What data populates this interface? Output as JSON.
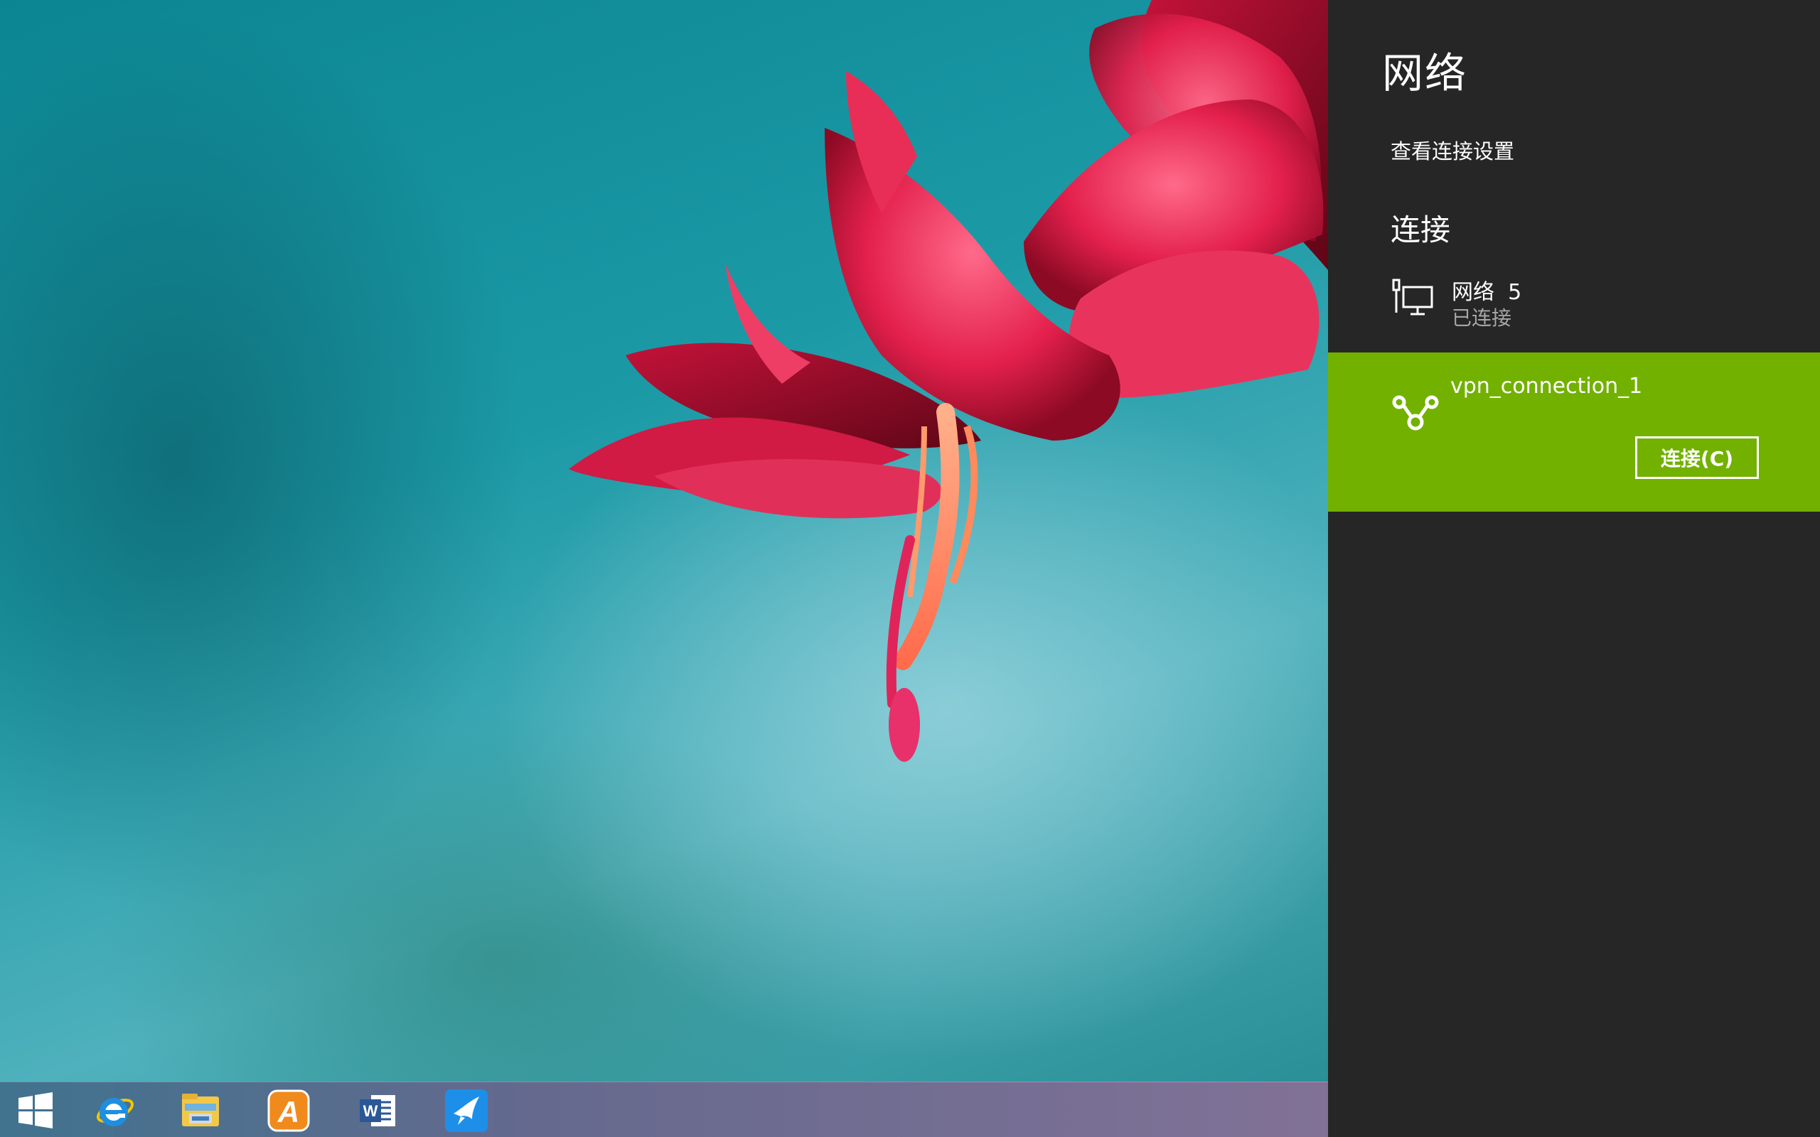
{
  "network_panel": {
    "title": "网络",
    "view_settings_link": "查看连接设置",
    "connections_heading": "连接",
    "network_item": {
      "name": "网络  5",
      "status": "已连接",
      "icon": "wired-network-icon"
    },
    "vpn_item": {
      "name": "vpn_connection_1",
      "connect_button_label": "连接(C)",
      "icon": "vpn-icon",
      "background_color": "#72b100"
    },
    "background_color": "#262626"
  },
  "taskbar": {
    "items": [
      {
        "name": "start-button",
        "icon": "windows-logo-icon"
      },
      {
        "name": "internet-explorer",
        "icon": "internet-explorer-icon"
      },
      {
        "name": "file-explorer",
        "icon": "file-explorer-icon"
      },
      {
        "name": "app-store-a",
        "icon": "letter-a-app-icon"
      },
      {
        "name": "microsoft-word",
        "icon": "word-icon"
      },
      {
        "name": "bird-app",
        "icon": "bird-app-icon"
      }
    ]
  }
}
